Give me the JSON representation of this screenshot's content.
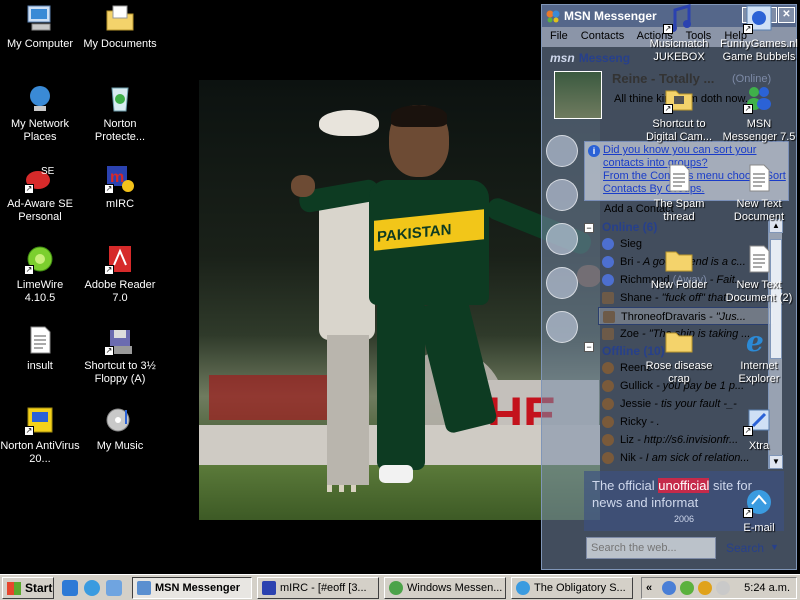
{
  "desktop_icons_left": [
    {
      "label": "My Computer",
      "icon": "computer-icon"
    },
    {
      "label": "My Documents",
      "icon": "folder-documents-icon"
    },
    {
      "label": "My Network Places",
      "icon": "network-icon"
    },
    {
      "label": "Norton Protecte...",
      "icon": "recycle-bin-icon"
    },
    {
      "label": "Ad-Aware SE Personal",
      "icon": "adaware-icon"
    },
    {
      "label": "mIRC",
      "icon": "mirc-icon"
    },
    {
      "label": "LimeWire 4.10.5",
      "icon": "limewire-icon"
    },
    {
      "label": "Adobe Reader 7.0",
      "icon": "adobe-reader-icon"
    },
    {
      "label": "insult",
      "icon": "text-document-icon"
    },
    {
      "label": "Shortcut to 3½ Floppy (A)",
      "icon": "floppy-icon"
    },
    {
      "label": "Norton AntiVirus 20...",
      "icon": "norton-icon"
    },
    {
      "label": "My Music",
      "icon": "music-folder-icon"
    }
  ],
  "desktop_icons_right": [
    {
      "label": "Musicmatch JUKEBOX",
      "icon": "musicmatch-icon"
    },
    {
      "label": "FunnyGames.nl Game Bubbels",
      "icon": "game-icon"
    },
    {
      "label": "Shortcut to Digital Cam...",
      "icon": "folder-camera-icon"
    },
    {
      "label": "MSN Messenger 7.5",
      "icon": "msn-people-icon"
    },
    {
      "label": "The Spam thread",
      "icon": "text-document-icon"
    },
    {
      "label": "New Text Document",
      "icon": "text-document-icon"
    },
    {
      "label": "New Folder",
      "icon": "folder-icon"
    },
    {
      "label": "New Text Document (2)",
      "icon": "text-document-icon"
    },
    {
      "label": "Rose disease crap",
      "icon": "folder-icon"
    },
    {
      "label": "Internet Explorer",
      "icon": "internet-explorer-icon"
    },
    {
      "label": "Xtra",
      "icon": "xtra-icon"
    },
    {
      "label": "E-mail",
      "icon": "email-icon"
    }
  ],
  "photo": {
    "jersey_text": "PAKISTAN",
    "billboard_text": "HE"
  },
  "msn": {
    "title": "MSN Messenger",
    "menu": [
      "File",
      "Contacts",
      "Actions",
      "Tools",
      "Help"
    ],
    "brand": {
      "msn": "msn",
      "messenger": "Messeng"
    },
    "profile": {
      "name": "Reine - Totally ...",
      "status": "(Online)",
      "personal_message": "All thine kingdom doth now..."
    },
    "tip": {
      "line1": "Did you know you can sort your contacts into groups?",
      "line2": "From the Contacts menu choose Sort Contacts By Groups."
    },
    "add_contact": "Add a Contact",
    "online_group": "Online (6)",
    "online_contacts": [
      {
        "name": "Sieg",
        "status": "",
        "message": ""
      },
      {
        "name": "Bri",
        "status": "",
        "message": "- A good friend is a c..."
      },
      {
        "name": "Richmond",
        "status": "(Away)",
        "message": "- Fait..."
      },
      {
        "name": "Shane",
        "status": "",
        "message": "- \"fuck off\" that..."
      },
      {
        "name": "ThroneofDravaris",
        "status": "",
        "message": "- \"Jus..."
      },
      {
        "name": "Zoe",
        "status": "",
        "message": "- \"The ship is taking ..."
      }
    ],
    "offline_group": "Offline (10)",
    "offline_contacts": [
      {
        "name": "Reeno",
        "message": ""
      },
      {
        "name": "Gullick",
        "message": "- you pay be 1 p..."
      },
      {
        "name": "Jessie",
        "message": "- tis your fault -_-"
      },
      {
        "name": "Ricky",
        "message": "- ."
      },
      {
        "name": "Liz",
        "message": "- http://s6.invisionfr..."
      },
      {
        "name": "Nik",
        "message": "- I am sick of relation..."
      }
    ],
    "ad": {
      "part1": "The official",
      "highlight": "unofficial",
      "part2": "site for news and informat",
      "date": "2006"
    },
    "search_placeholder": "Search the web...",
    "search_button": "Search"
  },
  "taskbar": {
    "start": "Start",
    "buttons": [
      {
        "label": "MSN Messenger",
        "active": true
      },
      {
        "label": "mIRC - [#eoff [3...",
        "active": false
      },
      {
        "label": "Windows Messen...",
        "active": false
      },
      {
        "label": "The Obligatory S...",
        "active": false
      }
    ],
    "tray_chevron": "«",
    "clock": "5:24 a.m."
  }
}
